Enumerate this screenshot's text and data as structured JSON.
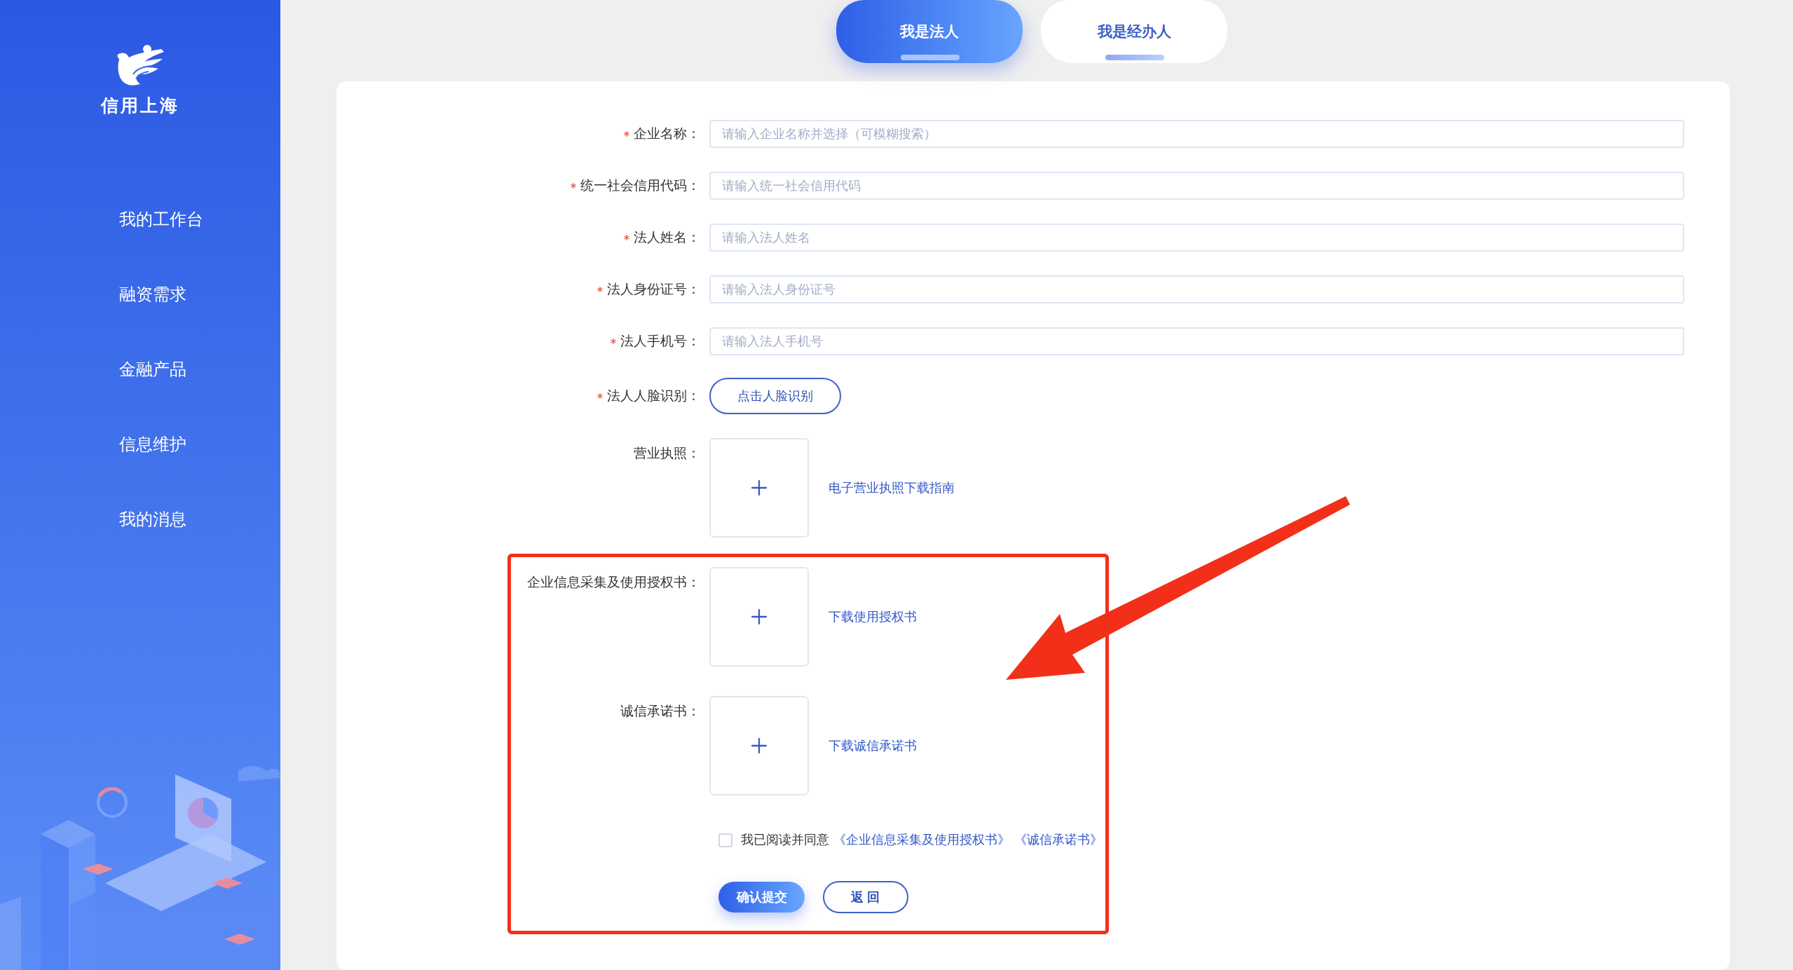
{
  "logo": {
    "text": "信用上海"
  },
  "nav": [
    {
      "label": "我的工作台"
    },
    {
      "label": "融资需求"
    },
    {
      "label": "金融产品"
    },
    {
      "label": "信息维护"
    },
    {
      "label": "我的消息"
    }
  ],
  "tabs": [
    {
      "label": "我是法人",
      "selected": true
    },
    {
      "label": "我是经办人",
      "selected": false
    }
  ],
  "fields": [
    {
      "kind": "input",
      "label": "企业名称：",
      "required": true,
      "placeholder": "请输入企业名称并选择（可模糊搜索）"
    },
    {
      "kind": "input",
      "label": "统一社会信用代码：",
      "required": true,
      "placeholder": "请输入统一社会信用代码"
    },
    {
      "kind": "input",
      "label": "法人姓名：",
      "required": true,
      "placeholder": "请输入法人姓名"
    },
    {
      "kind": "input",
      "label": "法人身份证号：",
      "required": true,
      "placeholder": "请输入法人身份证号"
    },
    {
      "kind": "input",
      "label": "法人手机号：",
      "required": true,
      "placeholder": "请输入法人手机号"
    },
    {
      "kind": "button",
      "label": "法人人脸识别：",
      "required": true,
      "button": "点击人脸识别"
    },
    {
      "kind": "upload",
      "label": "营业执照：",
      "required": false,
      "link": "电子营业执照下载指南"
    },
    {
      "kind": "upload",
      "label": "企业信息采集及使用授权书：",
      "required": false,
      "link": "下载使用授权书"
    },
    {
      "kind": "upload",
      "label": "诚信承诺书：",
      "required": false,
      "link": "下载诚信承诺书"
    }
  ],
  "agreement": {
    "checked": false,
    "text": "我已阅读并同意",
    "links": [
      "《企业信息采集及使用授权书》",
      "《诚信承诺书》"
    ]
  },
  "actions": [
    {
      "label": "确认提交",
      "kind": "primary"
    },
    {
      "label": "返 回",
      "kind": "secondary"
    }
  ]
}
